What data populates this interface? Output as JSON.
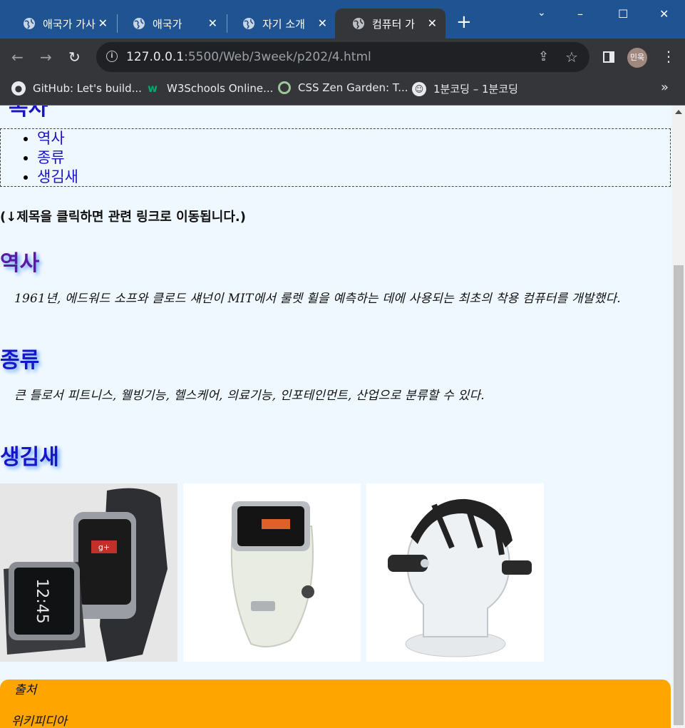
{
  "browser": {
    "tabs": [
      {
        "label": "애국가 가사"
      },
      {
        "label": "애국가"
      },
      {
        "label": "자기 소개"
      },
      {
        "label": "컴퓨터 가"
      }
    ],
    "new_tab": "+",
    "window_controls": {
      "minimize": "–",
      "maximize": "☐",
      "close": "✕"
    },
    "address": {
      "host": "127.0.0.1",
      "path": ":5500/Web/3week/p202/4.html"
    },
    "profile_initials": "민욱",
    "bookmarks": [
      {
        "label": "GitHub: Let's build...",
        "icon": "github-icon",
        "color": "#ffffff"
      },
      {
        "label": "W3Schools Online...",
        "icon": "w3schools-icon",
        "color": "#04aa6d"
      },
      {
        "label": "CSS Zen Garden: T...",
        "icon": "zen-garden-icon",
        "color": "#9ec79b"
      },
      {
        "label": "1분코딩 – 1분코딩",
        "icon": "1mincoding-icon",
        "color": "#ffffff"
      }
    ],
    "bookmarks_overflow": "»"
  },
  "page": {
    "toc": [
      "역사",
      "종류",
      "생김새"
    ],
    "hint": "(↓제목을 클릭하면 관련 링크로 이동됩니다.)",
    "sections": [
      {
        "title": "역사",
        "text": "1961년, 에드워드 소프와 클로드 섀넌이 MIT에서 룰렛 휠을 예측하는 데에 사용되는 최초의 착용 컴퓨터를 개발했다."
      },
      {
        "title": "종류",
        "text": "큰 틀로서 피트니스, 웰빙기능, 헬스케어, 의료기능, 인포테인먼트, 산업으로 분류할 수 있다."
      },
      {
        "title": "생김새",
        "text": ""
      }
    ],
    "gallery": [
      {
        "name": "smartwatch-photo",
        "screen_text": "12:45"
      },
      {
        "name": "galaxy-gear-photo",
        "screen_text": ""
      },
      {
        "name": "head-mounted-camera-photo",
        "screen_text": ""
      }
    ],
    "footer": {
      "line1": "출처",
      "line2": "위키피디아"
    }
  },
  "colors": {
    "link": "#1a14c9",
    "visited": "#5a1aa6",
    "page_bg": "#f0f8ff",
    "footer_bg": "#ffa500",
    "tabbar_bg": "#1f5391"
  }
}
